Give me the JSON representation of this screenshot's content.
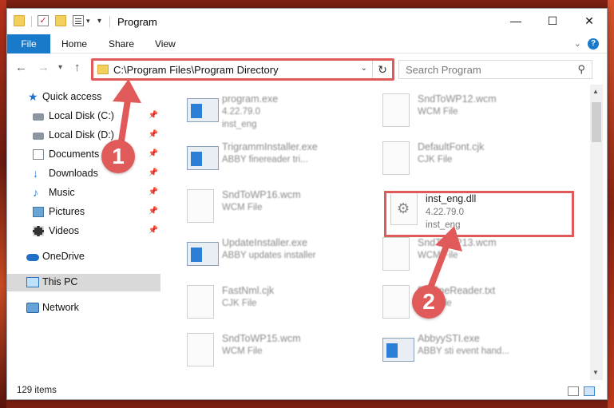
{
  "window": {
    "title": "Program",
    "minimize": "—",
    "maximize": "☐",
    "close": "✕"
  },
  "ribbon": {
    "file": "File",
    "home": "Home",
    "share": "Share",
    "view": "View"
  },
  "address": {
    "path": "C:\\Program Files\\Program Directory"
  },
  "search": {
    "placeholder": "Search Program"
  },
  "sidebar": {
    "items": [
      {
        "label": "Quick access"
      },
      {
        "label": "Local Disk (C:)"
      },
      {
        "label": "Local Disk (D:)"
      },
      {
        "label": "Documents"
      },
      {
        "label": "Downloads"
      },
      {
        "label": "Music"
      },
      {
        "label": "Pictures"
      },
      {
        "label": "Videos"
      },
      {
        "label": "OneDrive"
      },
      {
        "label": "This PC"
      },
      {
        "label": "Network"
      }
    ]
  },
  "files": [
    {
      "name": "program.exe",
      "sub": "4.22.79.0",
      "sub2": "inst_eng"
    },
    {
      "name": "SndToWP12.wcm",
      "sub": "WCM File"
    },
    {
      "name": "TrigrammInstaller.exe",
      "sub": "ABBY finereader tri..."
    },
    {
      "name": "DefaultFont.cjk",
      "sub": "CJK File"
    },
    {
      "name": "SndToWP16.wcm",
      "sub": "WCM File"
    },
    {
      "name": "inst_eng.dll",
      "sub": "4.22.79.0",
      "sub2": "inst_eng"
    },
    {
      "name": "UpdateInstaller.exe",
      "sub": "ABBY updates installer"
    },
    {
      "name": "SndToWP13.wcm",
      "sub": "WCM File"
    },
    {
      "name": "FastNml.cjk",
      "sub": "CJK File"
    },
    {
      "name": "finefineReader.txt",
      "sub": "Text File"
    },
    {
      "name": "SndToWP15.wcm",
      "sub": "WCM File"
    },
    {
      "name": "AbbyySTI.exe",
      "sub": "ABBY sti event hand..."
    }
  ],
  "status": {
    "count": "129 items"
  },
  "annotations": {
    "step1": "1",
    "step2": "2"
  },
  "colors": {
    "accent": "#1979ca",
    "annotation": "#e15a5a"
  }
}
